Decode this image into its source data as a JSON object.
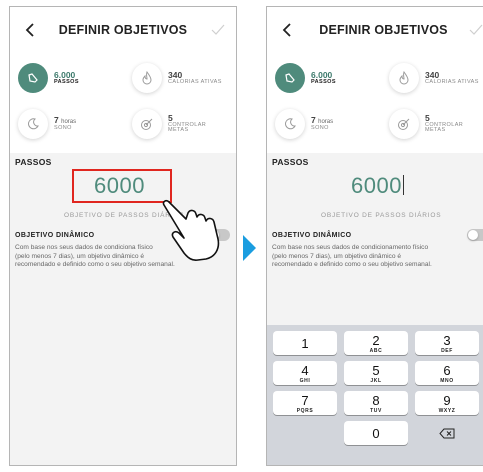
{
  "colors": {
    "accent": "#4f8b7c",
    "highlight": "#e0261f",
    "arrow": "#1a9de0"
  },
  "header": {
    "title": "DEFINIR OBJETIVOS"
  },
  "stats": {
    "steps": {
      "value": "6.000",
      "label": "PASSOS",
      "icon": "shoe-icon"
    },
    "calories": {
      "value": "340",
      "label": "CALORIAS ATIVAS",
      "icon": "flame-icon"
    },
    "sleep": {
      "value": "7",
      "unit": "horas",
      "label": "SONO",
      "icon": "moon-icon"
    },
    "goals": {
      "value": "5",
      "label_line1": "CONTROLAR",
      "label_line2": "METAS",
      "icon": "target-icon"
    }
  },
  "steps_section": {
    "title": "PASSOS",
    "value": "6000",
    "subtitle": "OBJETIVO DE PASSOS DIÁRIOS"
  },
  "dynamic": {
    "title": "OBJETIVO DINÂMICO",
    "line1": "Com base nos seus dados de condicionamento físico",
    "line2": "(pelo menos 7 dias), um objetivo dinâmico é",
    "line3": "recomendado e definido como o seu objetivo semanal.",
    "left_line1": "Com base nos seus dados de condiciona",
    "left_line1b": "físico",
    "left_line2": "(pelo menos 7 dias), um objetivo dinâmico é",
    "left_line3": "recomendado e definido como o seu objetivo semanal."
  },
  "keyboard": {
    "keys": [
      {
        "num": "1",
        "letters": ""
      },
      {
        "num": "2",
        "letters": "ABC"
      },
      {
        "num": "3",
        "letters": "DEF"
      },
      {
        "num": "4",
        "letters": "GHI"
      },
      {
        "num": "5",
        "letters": "JKL"
      },
      {
        "num": "6",
        "letters": "MNO"
      },
      {
        "num": "7",
        "letters": "PQRS"
      },
      {
        "num": "8",
        "letters": "TUV"
      },
      {
        "num": "9",
        "letters": "WXYZ"
      },
      {
        "num": "0",
        "letters": ""
      }
    ]
  }
}
